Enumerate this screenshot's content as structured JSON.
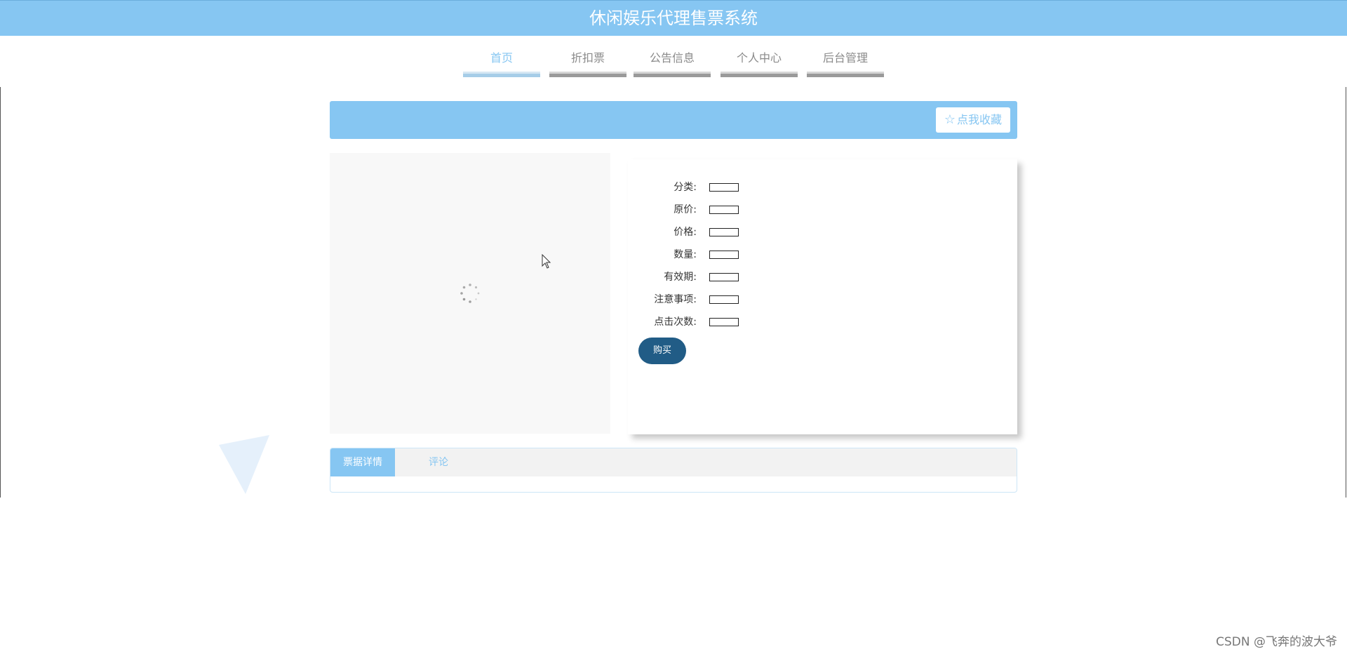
{
  "header": {
    "title": "休闲娱乐代理售票系统"
  },
  "nav": {
    "items": [
      {
        "label": "首页",
        "active": true
      },
      {
        "label": "折扣票",
        "active": false
      },
      {
        "label": "公告信息",
        "active": false
      },
      {
        "label": "个人中心",
        "active": false
      },
      {
        "label": "后台管理",
        "active": false
      }
    ]
  },
  "banner": {
    "favorite_label": "点我收藏"
  },
  "details": {
    "fields": [
      {
        "label": "分类:",
        "value": ""
      },
      {
        "label": "原价:",
        "value": ""
      },
      {
        "label": "价格:",
        "value": ""
      },
      {
        "label": "数量:",
        "value": ""
      },
      {
        "label": "有效期:",
        "value": ""
      },
      {
        "label": "注意事项:",
        "value": ""
      },
      {
        "label": "点击次数:",
        "value": ""
      }
    ],
    "buy_label": "购买"
  },
  "tabs": {
    "items": [
      {
        "label": "票据详情",
        "active": true
      },
      {
        "label": "评论",
        "active": false
      }
    ]
  },
  "watermark": "CSDN @飞奔的波大爷",
  "colors": {
    "accent": "#86c6f2",
    "buy_button": "#215c86",
    "nav_bar": "#9a9a9a",
    "image_placeholder": "#f8f8f8"
  }
}
